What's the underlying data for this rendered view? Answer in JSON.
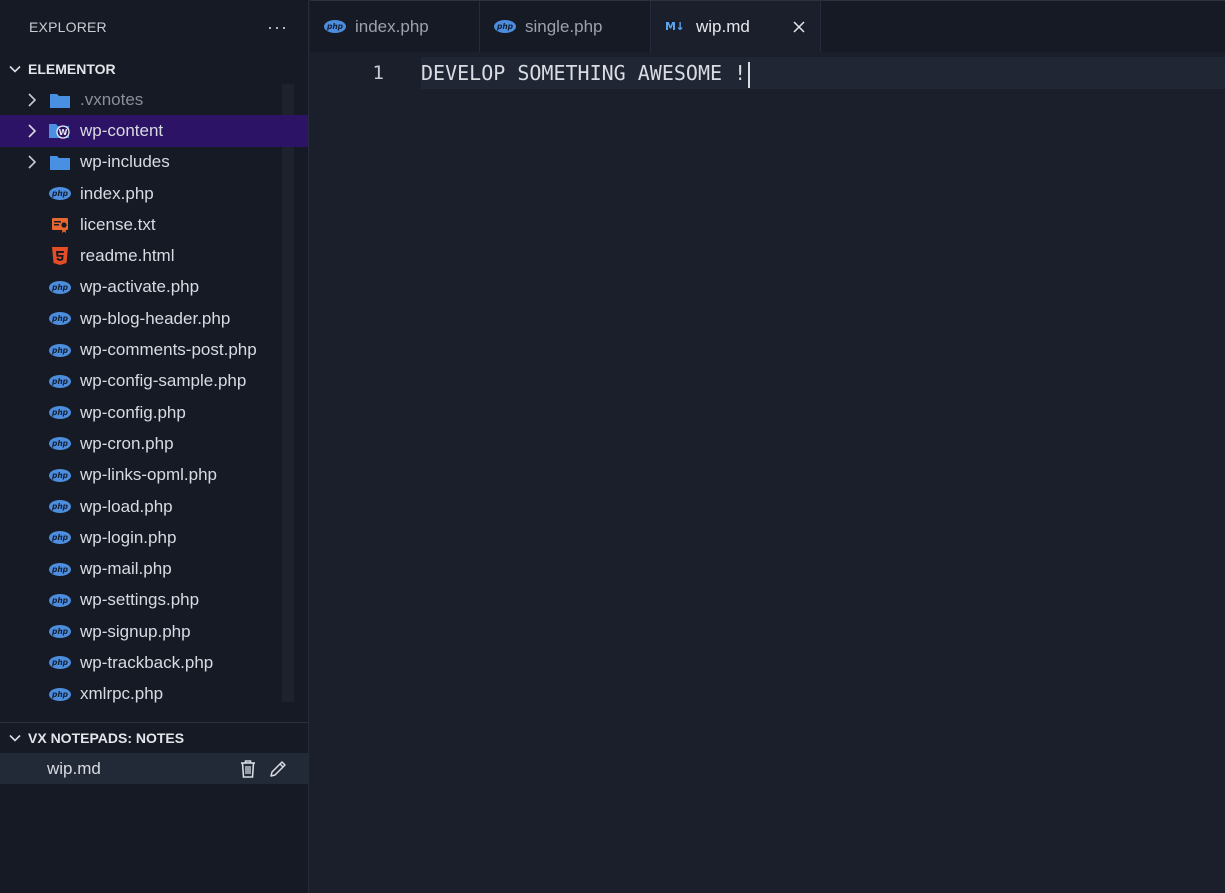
{
  "explorer": {
    "title": "EXPLORER",
    "more_label": "···",
    "workspace": "ELEMENTOR",
    "items": [
      {
        "label": ".vxnotes",
        "kind": "folder"
      },
      {
        "label": "wp-content",
        "kind": "folder-wp"
      },
      {
        "label": "wp-includes",
        "kind": "folder"
      },
      {
        "label": "index.php",
        "kind": "php"
      },
      {
        "label": "license.txt",
        "kind": "license"
      },
      {
        "label": "readme.html",
        "kind": "html"
      },
      {
        "label": "wp-activate.php",
        "kind": "php"
      },
      {
        "label": "wp-blog-header.php",
        "kind": "php"
      },
      {
        "label": "wp-comments-post.php",
        "kind": "php"
      },
      {
        "label": "wp-config-sample.php",
        "kind": "php"
      },
      {
        "label": "wp-config.php",
        "kind": "php"
      },
      {
        "label": "wp-cron.php",
        "kind": "php"
      },
      {
        "label": "wp-links-opml.php",
        "kind": "php"
      },
      {
        "label": "wp-load.php",
        "kind": "php"
      },
      {
        "label": "wp-login.php",
        "kind": "php"
      },
      {
        "label": "wp-mail.php",
        "kind": "php"
      },
      {
        "label": "wp-settings.php",
        "kind": "php"
      },
      {
        "label": "wp-signup.php",
        "kind": "php"
      },
      {
        "label": "wp-trackback.php",
        "kind": "php"
      },
      {
        "label": "xmlrpc.php",
        "kind": "php"
      }
    ]
  },
  "notes": {
    "title": "VX NOTEPADS: NOTES",
    "items": [
      {
        "label": "wip.md"
      }
    ]
  },
  "tabs": [
    {
      "label": "index.php",
      "icon": "php-icon"
    },
    {
      "label": "single.php",
      "icon": "php-icon"
    },
    {
      "label": "wip.md",
      "icon": "markdown-icon",
      "active": true
    }
  ],
  "icons": {
    "php_text": "php",
    "md_text": "M↓"
  },
  "editor": {
    "lines": [
      {
        "number": "1",
        "text": "DEVELOP SOMETHING AWESOME !"
      }
    ]
  },
  "colors": {
    "selection": "#2d1366",
    "php": "#4c8dde",
    "html": "#e44d26",
    "folder": "#4a90e2"
  }
}
